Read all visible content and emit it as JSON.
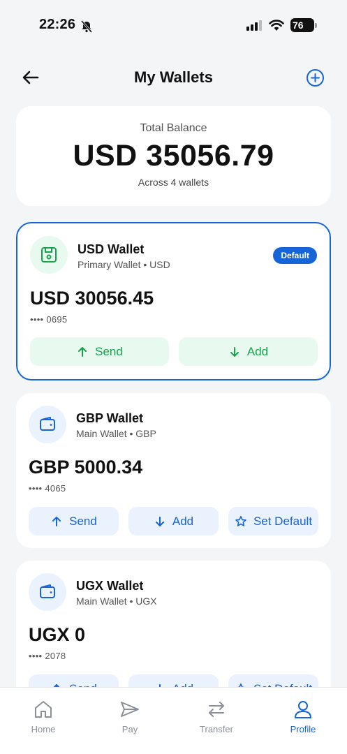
{
  "status_bar": {
    "time": "22:26",
    "battery": "76"
  },
  "header": {
    "title": "My Wallets"
  },
  "total": {
    "label": "Total Balance",
    "amount": "USD 35056.79",
    "subtitle": "Across 4 wallets"
  },
  "wallets": [
    {
      "name": "USD Wallet",
      "subtitle": "Primary Wallet • USD",
      "balance": "USD 30056.45",
      "masked": "•••• 0695",
      "badge": "Default",
      "send": "Send",
      "add": "Add"
    },
    {
      "name": "GBP Wallet",
      "subtitle": "Main Wallet • GBP",
      "balance": "GBP 5000.34",
      "masked": "•••• 4065",
      "send": "Send",
      "add": "Add",
      "set_default": "Set Default"
    },
    {
      "name": "UGX Wallet",
      "subtitle": "Main Wallet • UGX",
      "balance": "UGX 0",
      "masked": "•••• 2078",
      "send": "Send",
      "add": "Add",
      "set_default": "Set Default"
    }
  ],
  "nav": {
    "home": "Home",
    "pay": "Pay",
    "transfer": "Transfer",
    "profile": "Profile"
  },
  "colors": {
    "accent": "#1565d8",
    "success": "#17a34a",
    "background": "#f4f5f7"
  }
}
